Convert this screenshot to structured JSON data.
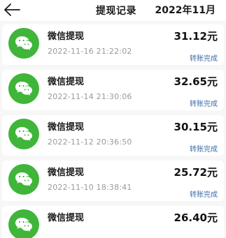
{
  "header": {
    "title": "提现记录",
    "month": "2022年11月"
  },
  "records": [
    {
      "name": "微信提现",
      "time": "2022-11-16 21:22:02",
      "amount": "31.12元",
      "status": "转账完成"
    },
    {
      "name": "微信提现",
      "time": "2022-11-14 21:30:06",
      "amount": "32.65元",
      "status": "转账完成"
    },
    {
      "name": "微信提现",
      "time": "2022-11-12 20:36:50",
      "amount": "30.15元",
      "status": "转账完成"
    },
    {
      "name": "微信提现",
      "time": "2022-11-10 18:38:41",
      "amount": "25.72元",
      "status": "转账完成"
    },
    {
      "name": "微信提现",
      "time": "",
      "amount": "26.40元",
      "status": ""
    }
  ],
  "colors": {
    "wechat_green": "#3fb53a",
    "status_blue": "#3f6fa8"
  },
  "icons": {
    "back": "arrow-left-icon",
    "avatar": "wechat-icon"
  }
}
